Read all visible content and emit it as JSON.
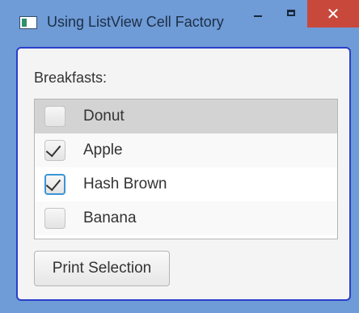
{
  "window": {
    "title": "Using ListView Cell Factory",
    "controls": {
      "minimize": "minimize-icon",
      "maximize": "maximize-icon",
      "close": "close-icon",
      "close_glyph": "✕"
    }
  },
  "content": {
    "label": "Breakfasts:",
    "items": [
      {
        "label": "Donut",
        "checked": false,
        "selected": true,
        "focused": false
      },
      {
        "label": "Apple",
        "checked": true,
        "selected": false,
        "focused": false
      },
      {
        "label": "Hash Brown",
        "checked": true,
        "selected": false,
        "focused": true
      },
      {
        "label": "Banana",
        "checked": false,
        "selected": false,
        "focused": false
      }
    ],
    "button_label": "Print Selection"
  },
  "colors": {
    "title_bar": "#6f9bd6",
    "close_button": "#c9483c",
    "focus_border": "#2a3fc9",
    "checkbox_focus": "#3a96d6",
    "selected_row": "#d3d3d3"
  }
}
